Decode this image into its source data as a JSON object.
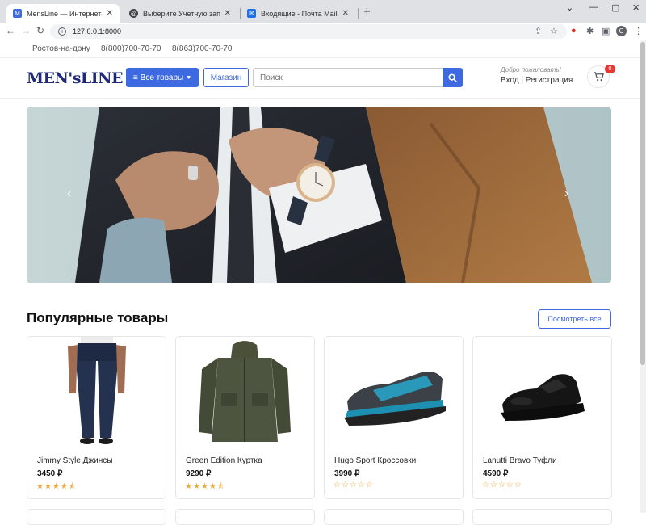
{
  "browser": {
    "tabs": [
      {
        "title": "MensLine — Интернет-магазин",
        "close": "✕"
      },
      {
        "title": "Выберите Учетную запись для...",
        "close": "✕"
      },
      {
        "title": "Входящие - Почта Mail.ru",
        "close": "✕"
      }
    ],
    "new_tab": "+",
    "url": "127.0.0.1:8000",
    "profile_initial": "C"
  },
  "topbar": {
    "city": "Ростов-на-дону",
    "phone1": "8(800)700-70-70",
    "phone2": "8(863)700-70-70"
  },
  "header": {
    "logo": "MEN'sLINE",
    "all_products": "Все товары",
    "shop": "Магазин",
    "search_placeholder": "Поиск",
    "welcome": "Добро пожаловать!",
    "login": "Вход",
    "register": "Регистрация",
    "cart_count": "0"
  },
  "carousel": {
    "prev": "‹",
    "next": "›"
  },
  "popular": {
    "title": "Популярные товары",
    "see_all": "Посмотреть все",
    "products": [
      {
        "name": "Jimmy Style Джинсы",
        "price": "3450 ₽",
        "stars": "★★★★⯪",
        "rating": 4.5
      },
      {
        "name": "Green Edition Куртка",
        "price": "9290 ₽",
        "stars": "★★★★⯪",
        "rating": 4.5
      },
      {
        "name": "Hugo Sport Кроссовки",
        "price": "3990 ₽",
        "stars": "☆☆☆☆☆",
        "rating": 0
      },
      {
        "name": "Lanutti Bravo Туфли",
        "price": "4590 ₽",
        "stars": "☆☆☆☆☆",
        "rating": 0
      }
    ]
  },
  "colors": {
    "accent": "#3e6ae1",
    "star": "#f0a93b",
    "badge": "#e53935"
  }
}
